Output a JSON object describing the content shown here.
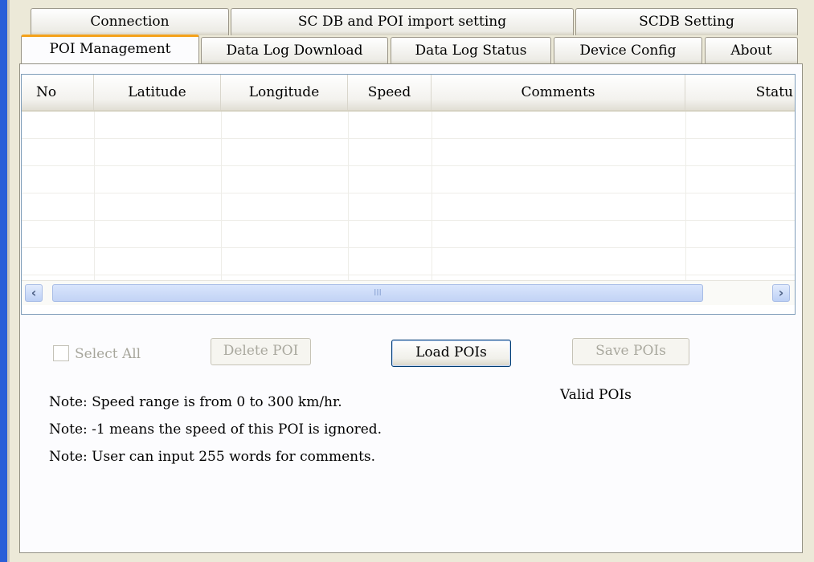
{
  "tabs": {
    "row1": [
      "Connection",
      "SC DB and POI import setting",
      "SCDB  Setting"
    ],
    "row2": [
      "POI Management",
      "Data Log Download",
      "Data Log Status",
      "Device Config",
      "About"
    ]
  },
  "table": {
    "columns": [
      "No",
      "Latitude",
      "Longitude",
      "Speed",
      "Comments",
      "Statu"
    ],
    "rows": []
  },
  "scrollbar": {
    "left_icon": "‹",
    "right_icon": "›",
    "grip_icon": "III"
  },
  "controls": {
    "select_all_label": "Select All",
    "select_all_checked": false,
    "delete_label": "Delete POI",
    "load_label": "Load POIs",
    "save_label": "Save POIs"
  },
  "notes": [
    "Note: Speed range is from 0 to 300 km/hr.",
    "Note: -1 means the speed of this POI is ignored.",
    "Note:  User can input 255 words for comments."
  ],
  "valid_label": "Valid POIs",
  "colors": {
    "accent_tab": "#f4a21b",
    "title_bar_blue": "#2a5ed8",
    "scrollbar_blue": "#c2d3f5",
    "button_border": "#003c74"
  }
}
